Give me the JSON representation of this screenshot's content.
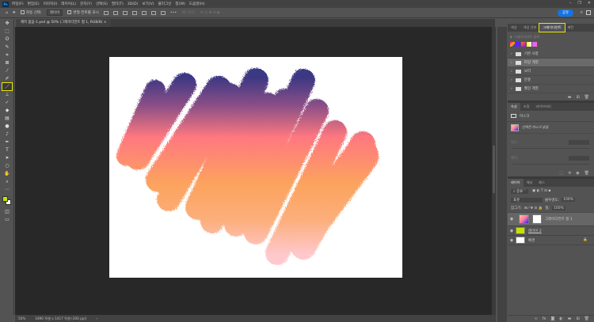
{
  "app": {
    "logo": "Ps",
    "menus": [
      "파일(F)",
      "편집(E)",
      "이미지(I)",
      "레이어(L)",
      "문자(Y)",
      "선택(S)",
      "필터(T)",
      "3D(D)",
      "보기(V)",
      "플러그인",
      "창(W)",
      "도움말(H)"
    ],
    "window_controls": [
      "–",
      "❐",
      "✕"
    ]
  },
  "options": {
    "auto_select_label": "자동 선택:",
    "auto_select_value": "레이어",
    "show_transform_label": "변형 컨트롤 표시",
    "more": "•••",
    "mode_3d": "3D 모드:",
    "share": "공유"
  },
  "document": {
    "tab_title": "제목 없음-1.psd @ 50% (그레이디언트 칠 1, RGB/8)",
    "tab_close": "×"
  },
  "status": {
    "zoom": "50%",
    "size": "1890 픽셀 x 1417 픽셀 (300 ppi)",
    "arrow": "›"
  },
  "tools": [
    "move",
    "marquee",
    "lasso",
    "quick-select",
    "crop",
    "frame",
    "eyedropper",
    "healing",
    "brush",
    "stamp",
    "history-brush",
    "eraser",
    "gradient",
    "blur",
    "dodge",
    "pen",
    "type",
    "path-select",
    "shape",
    "hand",
    "zoom",
    "more"
  ],
  "colors": {
    "foreground": "#c6e000",
    "background": "#ffffff",
    "highlight": "#e8e800",
    "share": "#1473e6"
  },
  "gradients_panel": {
    "tabs": [
      "색상",
      "색상 견본",
      "그레이디언트",
      "패턴"
    ],
    "active_tab": 2,
    "search_placeholder": "그레이디언트 검색",
    "folders": [
      "기본 사항",
      "파랑 계열",
      "보라",
      "분홍",
      "빨강 계열"
    ],
    "selected_folder": 1
  },
  "properties_panel": {
    "tabs": [
      "속성",
      "조정",
      "라이브러리"
    ],
    "mask_label": "마스크",
    "no_mask": "선택된 마스크 없음",
    "density": "밀도:",
    "feather": "페더:"
  },
  "layers_panel": {
    "tabs": [
      "레이어",
      "채널",
      "패스"
    ],
    "kind": "종류",
    "blend": "표준",
    "opacity_label": "불투명도:",
    "opacity": "100%",
    "lock_label": "잠그기:",
    "fill_label": "칠:",
    "fill": "100%",
    "layers": [
      {
        "name": "그레이디언트 칠 1"
      },
      {
        "name": "레이어 2"
      },
      {
        "name": "배경"
      }
    ]
  }
}
